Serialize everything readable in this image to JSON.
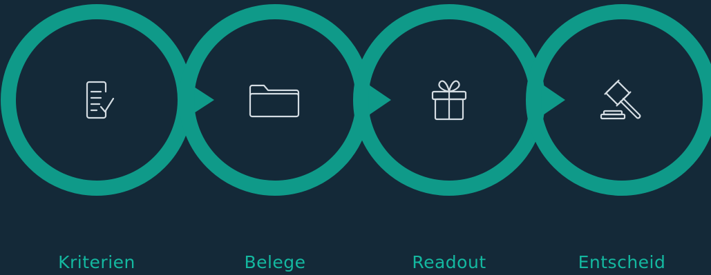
{
  "colors": {
    "background": "#142938",
    "ring": "#0f9a89",
    "icon_stroke": "#d5dde3",
    "label": "#14b8a0"
  },
  "steps": [
    {
      "label": "Kriterien",
      "icon": "checklist-icon"
    },
    {
      "label": "Belege",
      "icon": "folder-icon"
    },
    {
      "label": "Readout",
      "icon": "gift-icon"
    },
    {
      "label": "Entscheid",
      "icon": "gavel-icon"
    }
  ]
}
